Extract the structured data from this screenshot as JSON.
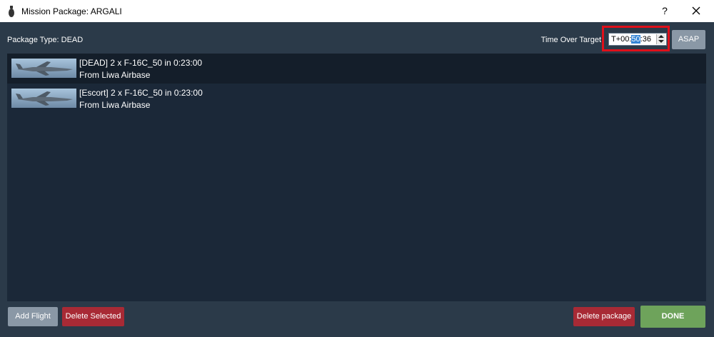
{
  "window": {
    "title": "Mission Package: ARGALI",
    "help_label": "?"
  },
  "header": {
    "package_type_label": "Package Type:",
    "package_type_value": "DEAD",
    "tot_label": "Time Over Target",
    "tot_prefix": "T+00:",
    "tot_selected": "50",
    "tot_suffix": ":36",
    "asap_label": "ASAP"
  },
  "flights": [
    {
      "line1": "[DEAD] 2 x F-16C_50 in 0:23:00",
      "line2": "From Liwa Airbase",
      "selected": true
    },
    {
      "line1": "[Escort] 2 x F-16C_50 in 0:23:00",
      "line2": "From Liwa Airbase",
      "selected": false
    }
  ],
  "footer": {
    "add_flight_label": "Add Flight",
    "delete_selected_label": "Delete Selected",
    "delete_package_label": "Delete package",
    "done_label": "DONE"
  },
  "colors": {
    "background": "#2b3a49",
    "list_background": "#1b2838",
    "accent_red": "#a82a35",
    "done_green": "#6ea35b",
    "neutral_button": "#8a98a6",
    "highlight_box": "#e0101a"
  },
  "icons": {
    "app": "bomb-icon",
    "close": "close-icon",
    "aircraft_thumbnail": "f16-aircraft-icon"
  }
}
